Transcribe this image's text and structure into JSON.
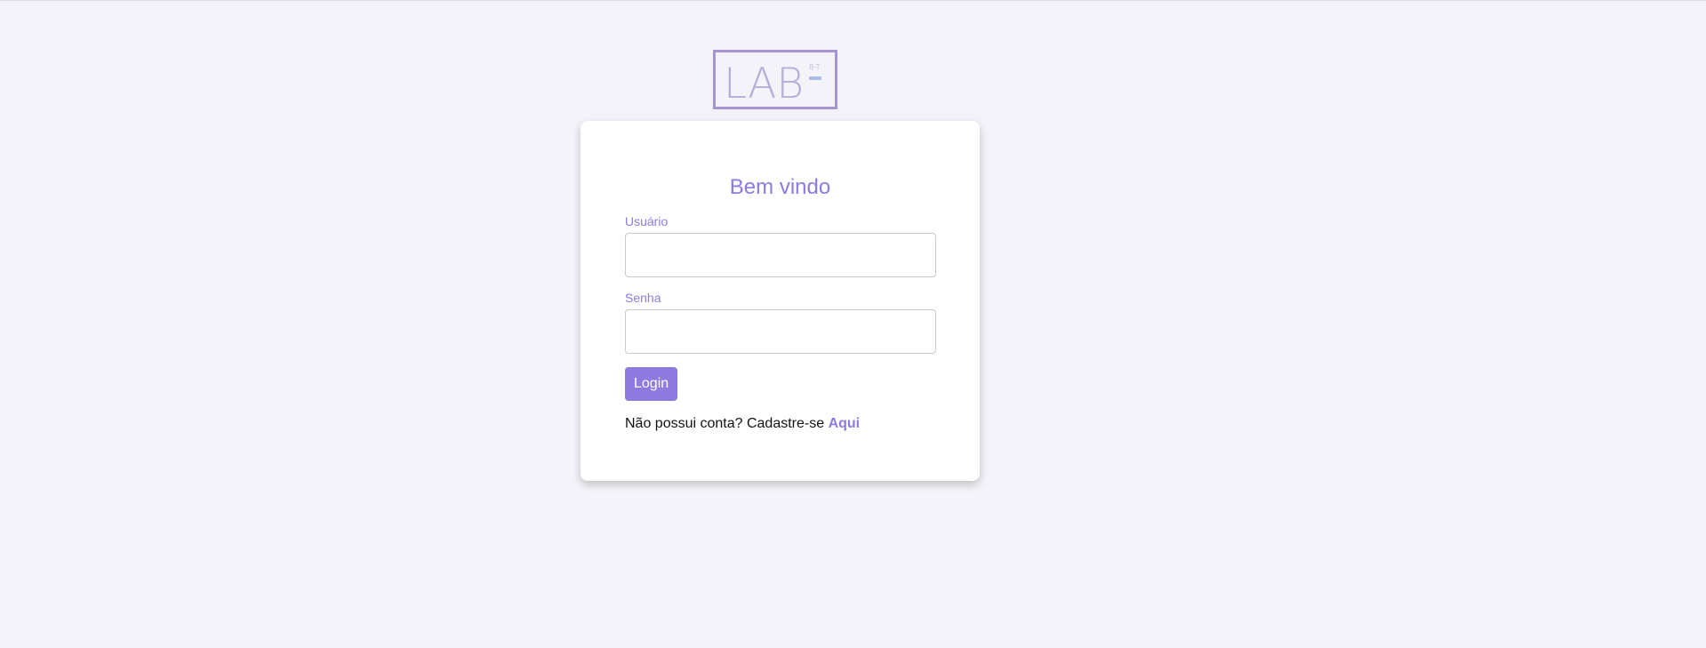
{
  "brand": {
    "logo_text": "LAB",
    "logo_superscript": "B-T",
    "color_frame": "#a596d0",
    "color_accent": "#aebee8"
  },
  "login": {
    "title": "Bem vindo",
    "username_label": "Usuário",
    "username_value": "",
    "password_label": "Senha",
    "password_value": "",
    "submit_label": "Login",
    "signup_prompt": "Não possui conta? Cadastre-se ",
    "signup_link": "Aqui"
  },
  "colors": {
    "accent": "#8f7ae0",
    "background": "#f4f3f9",
    "card": "#ffffff"
  }
}
